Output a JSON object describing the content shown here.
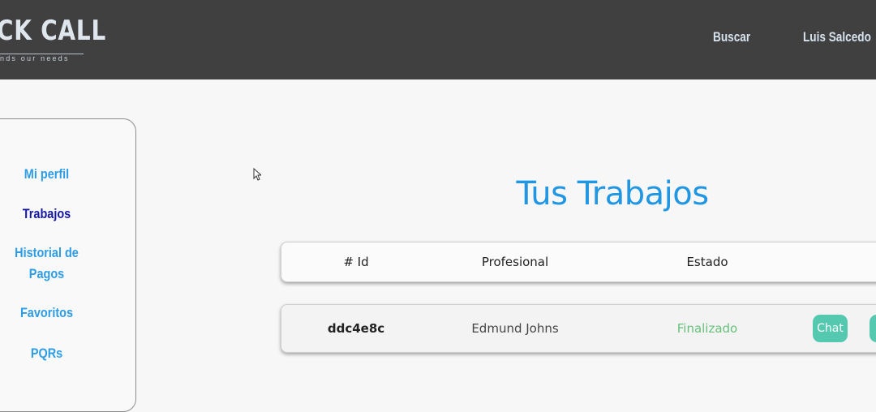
{
  "header": {
    "logo_text": "CK CALL",
    "tagline": "nds our needs",
    "nav": {
      "search": "Buscar",
      "user": "Luis Salcedo"
    }
  },
  "sidebar": {
    "items": [
      {
        "label": "Mi perfil"
      },
      {
        "label": "Trabajos"
      },
      {
        "label": "Historial de Pagos"
      },
      {
        "label": "Favoritos"
      },
      {
        "label": "PQRs"
      }
    ]
  },
  "main": {
    "title": "Tus Trabajos",
    "table": {
      "headers": [
        "# Id",
        "Profesional",
        "Estado"
      ],
      "rows": [
        {
          "id": "ddc4e8c",
          "professional": "Edmund Johns",
          "status": "Finalizado",
          "action": "Chat"
        }
      ]
    }
  },
  "colors": {
    "header_bg": "#404040",
    "accent_blue": "#2196e3",
    "active_nav": "#1518a4",
    "status_done": "#66c17a",
    "button_teal": "#55c9b0"
  }
}
